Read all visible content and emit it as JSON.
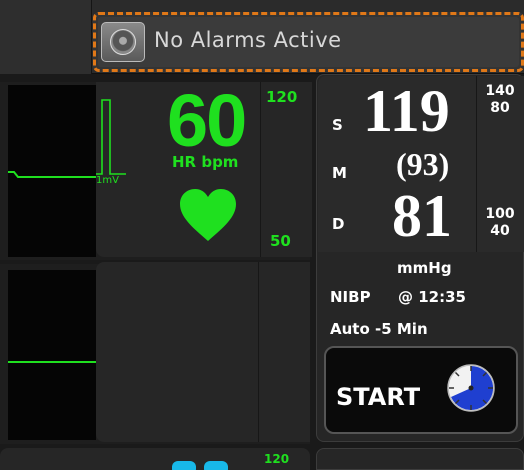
{
  "alarm": {
    "text": "No Alarms Active",
    "icon": "alarm-bell-icon",
    "border_color": "#e07818"
  },
  "ecg": {
    "scale_label": "1mV",
    "color": "#1fe01f"
  },
  "heart_rate": {
    "value": "60",
    "label": "HR bpm",
    "upper_limit": "120",
    "lower_limit": "50",
    "icon": "heart-icon"
  },
  "nibp": {
    "systolic_label": "S",
    "systolic": "119",
    "map_label": "M",
    "map": "(93)",
    "diastolic_label": "D",
    "diastolic": "81",
    "sys_limit_high": "140",
    "sys_limit_low": "80",
    "dia_limit_high": "100",
    "dia_limit_low": "40",
    "unit": "mmHg",
    "label": "NIBP",
    "time": "@ 12:35",
    "auto_interval": "Auto -5 Min",
    "start_label": "START",
    "timer_icon": "timer-icon"
  },
  "bottom": {
    "green_text": "120"
  }
}
